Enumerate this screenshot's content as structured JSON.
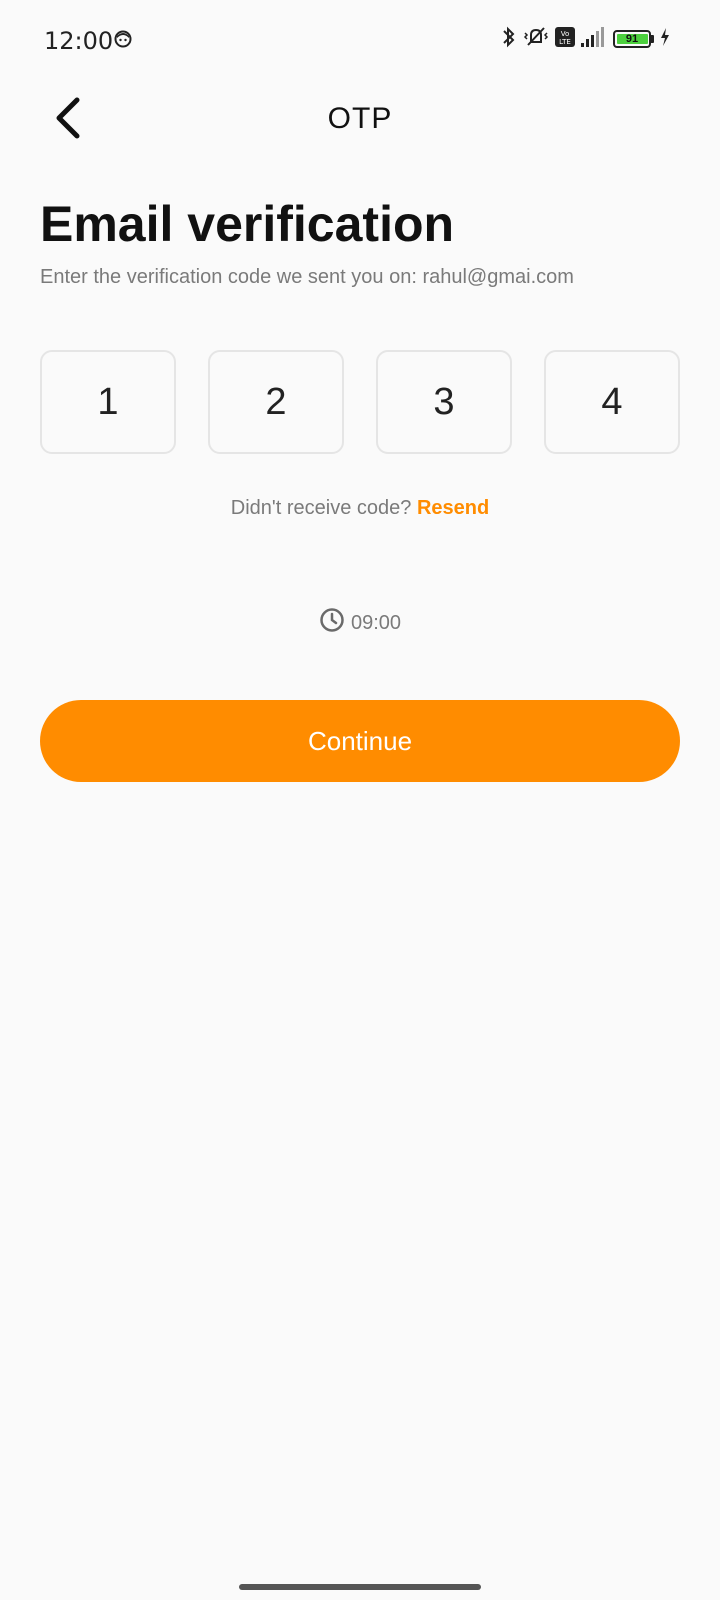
{
  "status_bar": {
    "time": "12:00",
    "battery_level": "91",
    "icons": [
      "face-icon",
      "bluetooth-icon",
      "mute-vibrate-icon",
      "volte-icon",
      "signal-icon",
      "battery-icon",
      "charging-icon"
    ]
  },
  "header": {
    "title": "OTP",
    "back_icon": "chevron-left-icon"
  },
  "main": {
    "heading": "Email verification",
    "subtitle": "Enter the verification code we sent you on: rahul@gmai.com",
    "otp_digits": [
      "1",
      "2",
      "3",
      "4"
    ],
    "resend_prompt": "Didn't receive code?",
    "resend_label": "Resend",
    "timer_icon": "clock-icon",
    "timer": "09:00",
    "continue_label": "Continue"
  },
  "colors": {
    "accent": "#ff8c00",
    "background": "#fafafa",
    "muted_text": "#7a7a7a",
    "battery_green": "#4cd03e"
  }
}
